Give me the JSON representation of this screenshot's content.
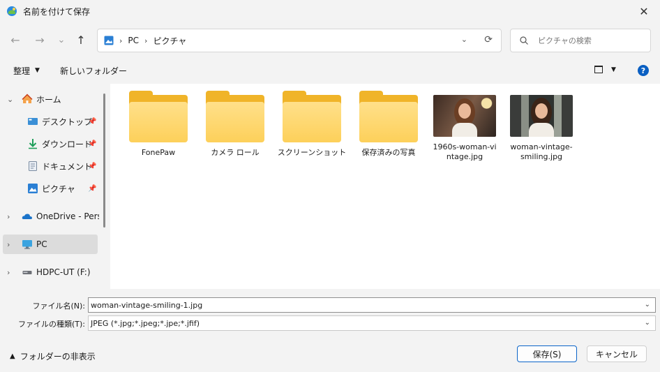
{
  "window": {
    "title": "名前を付けて保存",
    "close_glyph": "✕"
  },
  "nav": {
    "back": "←",
    "forward": "→",
    "recent": "⌄",
    "up": "↑"
  },
  "address": {
    "crumbs": [
      "PC",
      "ピクチャ"
    ],
    "separator": "›"
  },
  "search": {
    "placeholder": "ピクチャの検索"
  },
  "toolbar": {
    "organize_label": "整理",
    "new_folder_label": "新しいフォルダー",
    "help_label": "?"
  },
  "sidebar": {
    "items": [
      {
        "label": "ホーム",
        "icon": "home-icon",
        "expanded": true
      },
      {
        "label": "デスクトップ",
        "icon": "desktop-icon",
        "pinned": true
      },
      {
        "label": "ダウンロード",
        "icon": "download-icon",
        "pinned": true
      },
      {
        "label": "ドキュメント",
        "icon": "document-icon",
        "pinned": true
      },
      {
        "label": "ピクチャ",
        "icon": "pictures-icon",
        "pinned": true
      },
      {
        "label": "OneDrive - Perso",
        "icon": "onedrive-icon"
      },
      {
        "label": "PC",
        "icon": "pc-icon",
        "selected": true
      },
      {
        "label": "HDPC-UT (F:)",
        "icon": "drive-icon"
      }
    ]
  },
  "files": [
    {
      "name": "FonePaw",
      "kind": "folder"
    },
    {
      "name": "カメラ ロール",
      "kind": "folder"
    },
    {
      "name": "スクリーンショット",
      "kind": "folder"
    },
    {
      "name": "保存済みの写真",
      "kind": "folder"
    },
    {
      "name_line1": "1960s-woman-vi",
      "name_line2": "ntage.jpg",
      "kind": "image"
    },
    {
      "name_line1": "woman-vintage-",
      "name_line2": "smiling.jpg",
      "kind": "image"
    }
  ],
  "form": {
    "filename_label": "ファイル名(N):",
    "filename_value": "woman-vintage-smiling-1.jpg",
    "filetype_label": "ファイルの種類(T):",
    "filetype_value": "JPEG (*.jpg;*.jpeg;*.jpe;*.jfif)"
  },
  "footer": {
    "hide_folders_label": "フォルダーの非表示",
    "save_label": "保存(S)",
    "cancel_label": "キャンセル"
  },
  "colors": {
    "accent": "#0a64c8",
    "folder": "#f0b429",
    "help": "#0a5fc2"
  }
}
